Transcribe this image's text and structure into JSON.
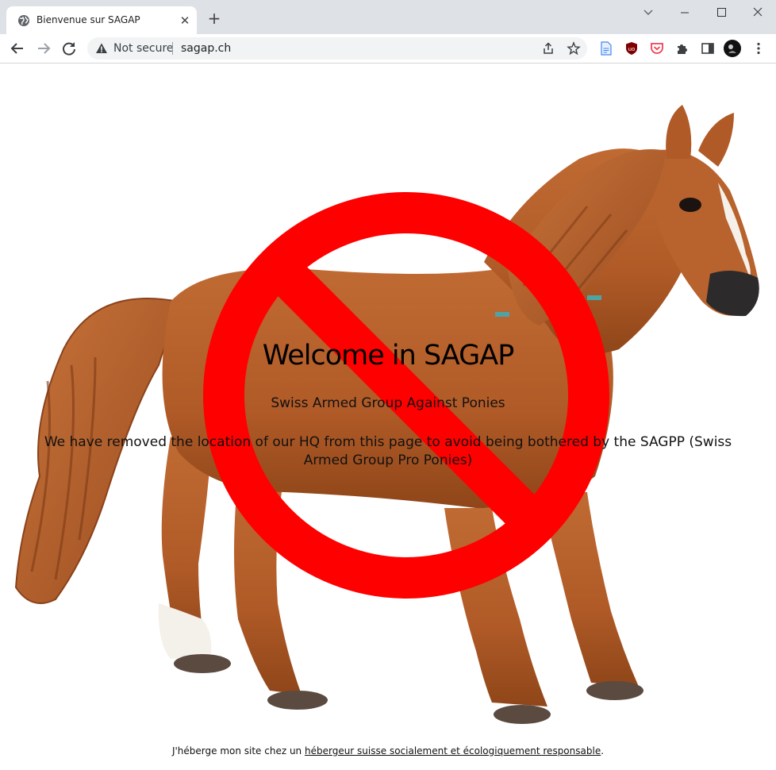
{
  "browser": {
    "tab_title": "Bienvenue sur SAGAP",
    "close_tab_glyph": "✕",
    "new_tab_glyph": "+",
    "security_label": "Not secure",
    "url": "sagap.ch"
  },
  "page": {
    "heading": "Welcome in SAGAP",
    "subtitle": "Swiss Armed Group Against Ponies",
    "message": "We have removed the location of our HQ from this page to avoid being bothered by the SAGPP (Swiss Armed Group Pro Ponies)",
    "footer_prefix": "J'héberge mon site chez un ",
    "footer_link": "hébergeur suisse socialement et écologiquement responsable",
    "footer_suffix": "."
  },
  "icons": [
    "globe-icon",
    "close-icon",
    "plus-icon",
    "chevron-down-icon",
    "minimize-icon",
    "maximize-icon",
    "window-close-icon",
    "back-arrow-icon",
    "forward-arrow-icon",
    "reload-icon",
    "warning-icon",
    "share-icon",
    "star-icon",
    "document-extension-icon",
    "ublock-icon",
    "pocket-icon",
    "puzzle-icon",
    "side-panel-icon",
    "profile-avatar",
    "kebab-menu-icon"
  ],
  "colors": {
    "prohibition_red": "#ff0000",
    "horse_brown": "#b4622e",
    "tab_strip": "#dee1e6",
    "omnibox_bg": "#f1f3f4"
  }
}
